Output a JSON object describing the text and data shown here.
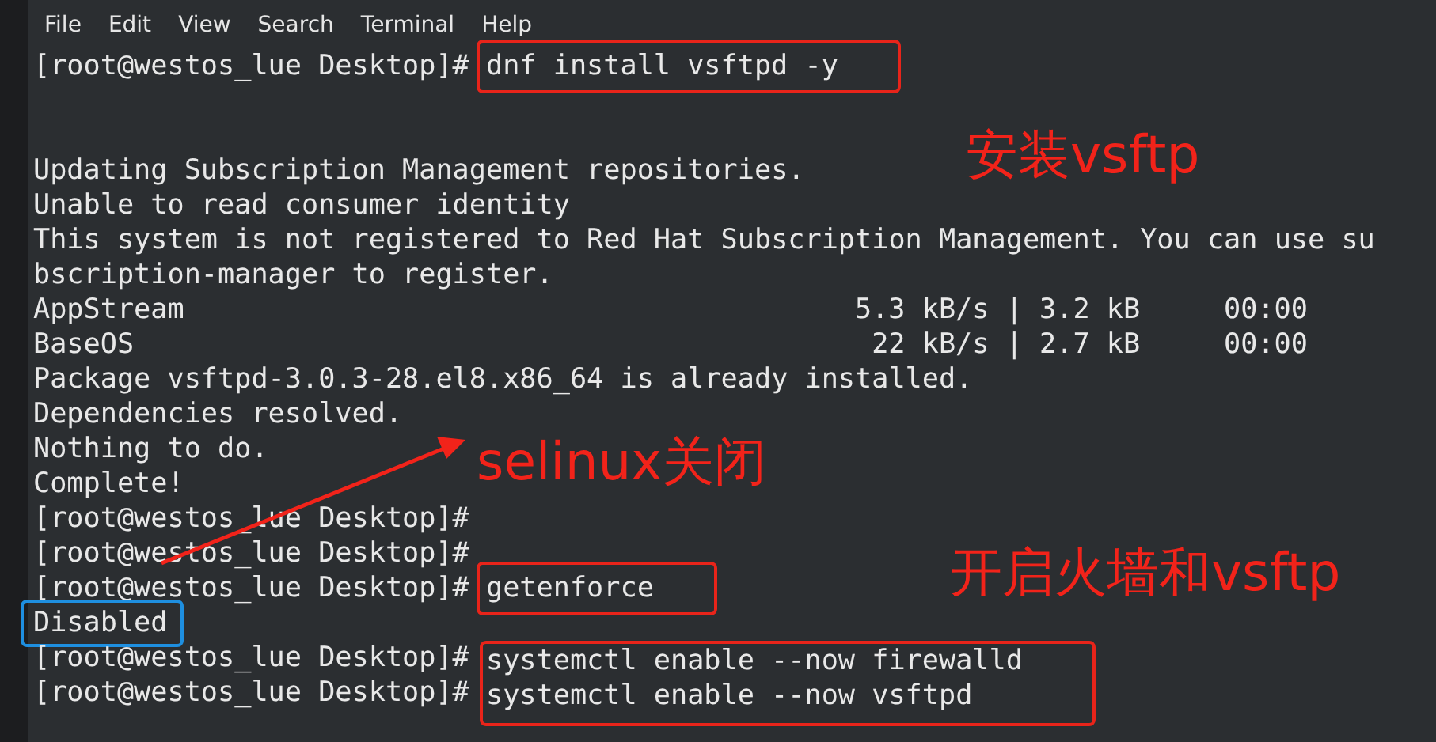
{
  "menu": [
    "File",
    "Edit",
    "View",
    "Search",
    "Terminal",
    "Help"
  ],
  "lines": [
    {
      "kind": "highlighted_command",
      "prompt": "[root@westos_lue Desktop]#",
      "command": "dnf install vsftpd -y"
    },
    {
      "kind": "blank"
    },
    {
      "kind": "blank"
    },
    {
      "kind": "output",
      "text": "Updating Subscription Management repositories."
    },
    {
      "kind": "output",
      "text": "Unable to read consumer identity"
    },
    {
      "kind": "output",
      "text": "This system is not registered to Red Hat Subscription Management. You can use su"
    },
    {
      "kind": "output",
      "text": "bscription-manager to register."
    },
    {
      "kind": "repo",
      "name": "AppStream",
      "rate": "5.3 kB/s",
      "sep": "|",
      "size": "3.2 kB",
      "time": "00:00"
    },
    {
      "kind": "repo",
      "name": "BaseOS",
      "rate": "22 kB/s",
      "sep": "|",
      "size": "2.7 kB",
      "time": "00:00"
    },
    {
      "kind": "output",
      "text": "Package vsftpd-3.0.3-28.el8.x86_64 is already installed."
    },
    {
      "kind": "output",
      "text": "Dependencies resolved."
    },
    {
      "kind": "output",
      "text": "Nothing to do."
    },
    {
      "kind": "output",
      "text": "Complete!"
    },
    {
      "kind": "command",
      "prompt": "[root@westos_lue Desktop]#"
    },
    {
      "kind": "command",
      "prompt": "[root@westos_lue Desktop]#"
    },
    {
      "kind": "highlighted_command",
      "prompt": "[root@westos_lue Desktop]#",
      "command": "getenforce"
    },
    {
      "kind": "highlighted_output",
      "text": "Disabled"
    },
    {
      "kind": "command_group",
      "items": [
        {
          "prompt": "[root@westos_lue Desktop]#",
          "command": "systemctl enable --now firewalld"
        },
        {
          "prompt": "[root@westos_lue Desktop]#",
          "command": "systemctl enable --now vsftpd"
        }
      ]
    }
  ],
  "annotations": [
    "安装vsftp",
    "selinux关闭",
    "开启火墙和vsftp"
  ]
}
